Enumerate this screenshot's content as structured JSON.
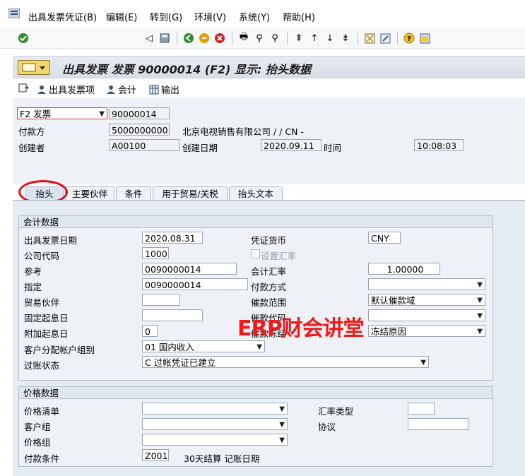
{
  "menu": [
    "出具发票凭证(B)",
    "编辑(E)",
    "转到(G)",
    "环境(V)",
    "系统(Y)",
    "帮助(H)"
  ],
  "title": "出具发票 发票 90000014  (F2) 显示: 抬头数据",
  "app_toolbar": {
    "items": [
      "出具发票项",
      "会计",
      "输出"
    ]
  },
  "header": {
    "billing_type": "F2 发票",
    "billing_doc": "90000014",
    "payer_label": "付款方",
    "payer_value": "5000000000",
    "payer_name": "北京电视销售有限公司 / / CN -",
    "created_by_label": "创建者",
    "created_by_value": "A00100",
    "created_on_label": "创建日期",
    "created_on_value": "2020.09.11",
    "time_label": "时间",
    "time_value": "10:08:03"
  },
  "tabs": [
    "抬头",
    "主要伙伴",
    "条件",
    "用于贸易/关税",
    "抬头文本"
  ],
  "accounting": {
    "title": "会计数据",
    "billing_date_label": "出具发票日期",
    "billing_date": "2020.08.31",
    "doc_currency_label": "凭证货币",
    "doc_currency": "CNY",
    "company_code_label": "公司代码",
    "company_code": "1000",
    "set_rate_label": "设置汇率",
    "reference_label": "参考",
    "reference": "0090000014",
    "exchange_rate_label": "会计汇率",
    "exchange_rate": "1.00000",
    "assignment_label": "指定",
    "assignment": "0090000014",
    "payment_method_label": "付款方式",
    "payment_method": "",
    "trading_partner_label": "贸易伙伴",
    "trading_partner": "",
    "dunning_area_label": "催款范围",
    "dunning_area": "默认催款域",
    "fixed_baseline_label": "固定起息日",
    "fixed_baseline": "",
    "dunning_key_label": "催款代码",
    "dunning_key": "",
    "addl_days_label": "附加起息日",
    "addl_days": "0",
    "dunning_block_label": "催款冻结",
    "dunning_block": "冻结原因",
    "acct_group_label": "客户分配帐户组别",
    "acct_group": "01 国内收入",
    "posting_status_label": "过账状态",
    "posting_status": "C 过帐凭证已建立"
  },
  "pricing": {
    "title": "价格数据",
    "price_list_label": "价格清单",
    "price_list": "",
    "exch_type_label": "汇率类型",
    "exch_type": "",
    "customer_group_label": "客户组",
    "customer_group": "",
    "agreement_label": "协议",
    "agreement": "",
    "price_group_label": "价格组",
    "price_group": "",
    "payment_terms_label": "付款条件",
    "payment_terms": "Z001",
    "payment_terms_desc": "30天结算 记账日期"
  },
  "watermark": "ERP财会讲堂"
}
